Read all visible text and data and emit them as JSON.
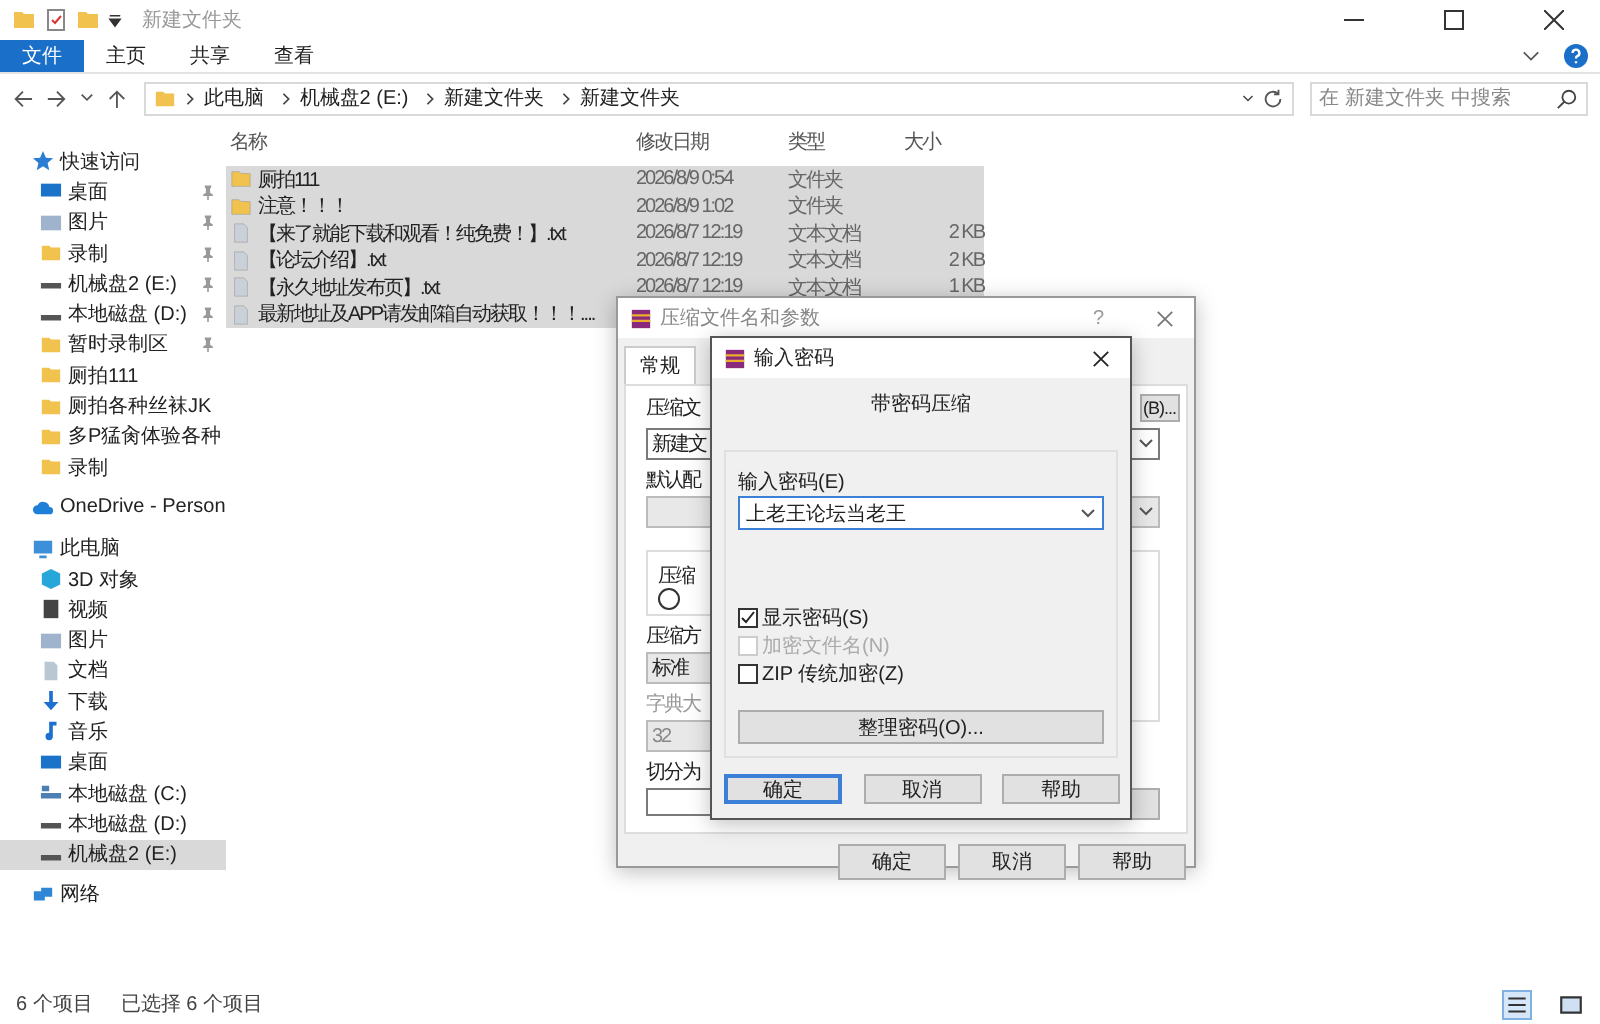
{
  "window": {
    "title": "新建文件夹"
  },
  "ribbon": {
    "tabs": [
      {
        "label": "文件",
        "selected": true
      },
      {
        "label": "主页",
        "selected": false
      },
      {
        "label": "共享",
        "selected": false
      },
      {
        "label": "查看",
        "selected": false
      }
    ]
  },
  "address": {
    "crumbs": [
      "此电脑",
      "机械盘2 (E:)",
      "新建文件夹",
      "新建文件夹"
    ]
  },
  "search": {
    "placeholder": "在 新建文件夹 中搜索"
  },
  "sidebar": {
    "items": [
      {
        "label": "快速访问",
        "kind": "star",
        "selected": false,
        "children": [
          {
            "label": "桌面",
            "kind": "desktop",
            "pinned": true,
            "selected": false
          },
          {
            "label": "图片",
            "kind": "picture",
            "pinned": true,
            "selected": false
          },
          {
            "label": "录制",
            "kind": "folder",
            "pinned": true,
            "selected": false
          },
          {
            "label": "机械盘2 (E:)",
            "kind": "drive",
            "pinned": true,
            "selected": false
          },
          {
            "label": "本地磁盘 (D:)",
            "kind": "drive",
            "pinned": true,
            "selected": false
          },
          {
            "label": "暂时录制区",
            "kind": "folder",
            "pinned": true,
            "selected": false
          },
          {
            "label": "厕拍111",
            "kind": "folder",
            "pinned": false,
            "selected": false
          },
          {
            "label": "厕拍各种丝袜JK",
            "kind": "folder",
            "pinned": false,
            "selected": false
          },
          {
            "label": "多P猛肏体验各种",
            "kind": "folder",
            "pinned": false,
            "selected": false
          },
          {
            "label": "录制",
            "kind": "folder",
            "pinned": false,
            "selected": false
          }
        ]
      },
      {
        "label": "OneDrive - Person",
        "kind": "cloud",
        "selected": false
      },
      {
        "label": "此电脑",
        "kind": "pc",
        "selected": false,
        "children": [
          {
            "label": "3D 对象",
            "kind": "cube",
            "selected": false
          },
          {
            "label": "视频",
            "kind": "video",
            "selected": false
          },
          {
            "label": "图片",
            "kind": "picture",
            "selected": false
          },
          {
            "label": "文档",
            "kind": "document",
            "selected": false
          },
          {
            "label": "下载",
            "kind": "download",
            "selected": false
          },
          {
            "label": "音乐",
            "kind": "music",
            "selected": false
          },
          {
            "label": "桌面",
            "kind": "desktop",
            "selected": false
          },
          {
            "label": "本地磁盘 (C:)",
            "kind": "system-drive",
            "selected": false
          },
          {
            "label": "本地磁盘 (D:)",
            "kind": "drive",
            "selected": false
          },
          {
            "label": "机械盘2 (E:)",
            "kind": "drive",
            "selected": true
          }
        ]
      },
      {
        "label": "网络",
        "kind": "network",
        "selected": false
      }
    ]
  },
  "table": {
    "columns": [
      "名称",
      "修改日期",
      "类型",
      "大小"
    ],
    "rows": [
      {
        "kind": "folder",
        "name": "厕拍111",
        "date": "2026/8/9 0:54",
        "type": "文件夹",
        "selected": true
      },
      {
        "kind": "folder",
        "name": "注意！！！",
        "date": "2026/8/9 1:02",
        "type": "文件夹",
        "selected": true
      },
      {
        "kind": "text",
        "name": "【来了就能下载和观看！纯免费！】.txt",
        "date": "2026/8/7 12:19",
        "type": "文本文档",
        "size": "2 KB",
        "selected": true
      },
      {
        "kind": "text",
        "name": "【论坛介绍】.txt",
        "date": "2026/8/7 12:19",
        "type": "文本文档",
        "size": "2 KB",
        "selected": true
      },
      {
        "kind": "text",
        "name": "【永久地址发布页】.txt",
        "date": "2026/8/7 12:19",
        "type": "文本文档",
        "size": "1 KB",
        "selected": true
      },
      {
        "kind": "text",
        "name": "最新地址及APP请发邮箱自动获取！！！....",
        "selected": true
      }
    ]
  },
  "status_bar": {
    "count": "6 个项目",
    "selection": "已选择 6 个项目"
  },
  "compress_dialog": {
    "title": "压缩文件名和参数",
    "help_button": "?",
    "tabs": [
      {
        "label": "常规",
        "selected": true
      }
    ],
    "archive_name_label": "压缩文",
    "browse_button": "(B)...",
    "archive_name": "新建文",
    "profile_label": "默认配",
    "format_label": "压缩",
    "format_radio": {
      "selected": false
    },
    "method_label": "压缩方",
    "method": "标准",
    "dictionary_label": "字典大",
    "dictionary": "32",
    "split_label": "切分为",
    "buttons": [
      "确定",
      "取消",
      "帮助"
    ]
  },
  "password_dialog": {
    "title": "输入密码",
    "heading": "带密码压缩",
    "password_label": "输入密码(E)",
    "password": "上老王论坛当老王",
    "options": [
      {
        "label": "显示密码(S)",
        "checked": true,
        "disabled": false
      },
      {
        "label": "加密文件名(N)",
        "checked": false,
        "disabled": true
      },
      {
        "label": "ZIP 传统加密(Z)",
        "checked": false,
        "disabled": false
      }
    ],
    "organize_button": "整理密码(O)...",
    "buttons": [
      {
        "label": "确定",
        "default": true
      },
      {
        "label": "取消",
        "default": false
      },
      {
        "label": "帮助",
        "default": false
      }
    ]
  }
}
